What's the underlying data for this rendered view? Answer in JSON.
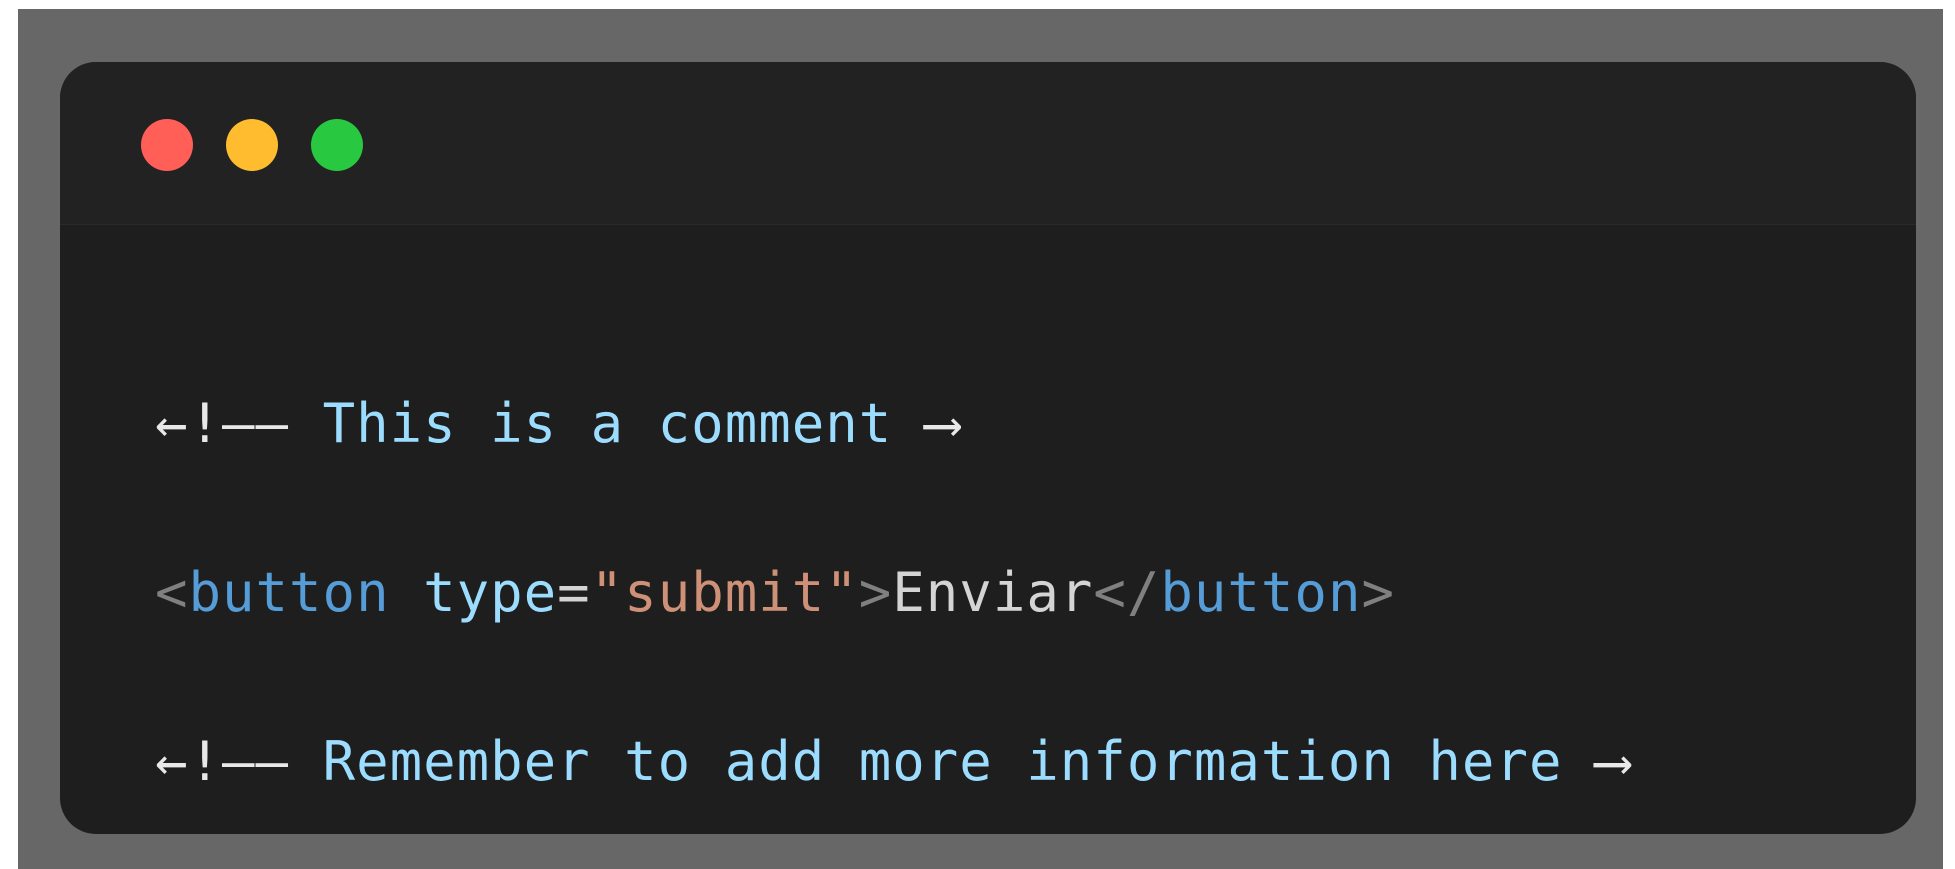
{
  "window": {
    "colors": {
      "backdrop": "#676767",
      "window_bg": "#1e1e1e",
      "titlebar_bg": "#222222",
      "close": "#ff5f57",
      "minimize": "#febc2e",
      "maximize": "#28c840"
    },
    "controls": [
      "close-dot",
      "minimize-dot",
      "maximize-dot"
    ]
  },
  "code": {
    "line1": {
      "open_mark": "←!—— ",
      "comment": "This is a comment",
      "close_mark": " ⟶"
    },
    "line2": {
      "lt": "<",
      "tag_open": "button",
      "space": " ",
      "attr_name": "type",
      "equals": "=",
      "attr_value": "\"submit\"",
      "gt": ">",
      "text": "Enviar",
      "lt_slash": "</",
      "tag_close": "button",
      "gt_end": ">"
    },
    "line3": {
      "open_mark": "←!—— ",
      "comment": "Remember to add more information here",
      "close_mark": " ⟶"
    }
  }
}
